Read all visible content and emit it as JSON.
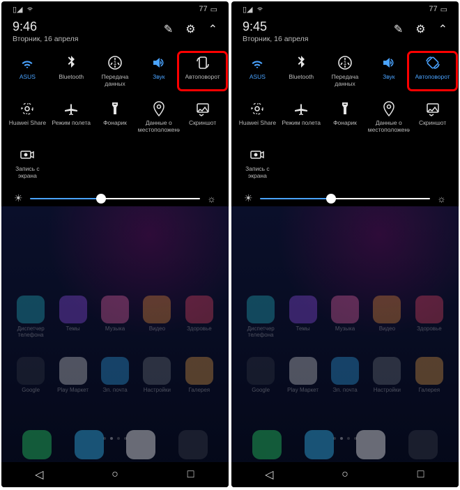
{
  "screens": [
    {
      "key": "left",
      "status": {
        "battery": "77"
      },
      "time": "9:46",
      "date": "Вторник, 16 апреля",
      "tiles": [
        {
          "id": "wifi",
          "label": "ASUS",
          "active": true,
          "highlight": false
        },
        {
          "id": "bluetooth",
          "label": "Bluetooth",
          "active": false,
          "highlight": false
        },
        {
          "id": "data",
          "label": "Передача данных",
          "active": false,
          "highlight": false
        },
        {
          "id": "sound",
          "label": "Звук",
          "active": true,
          "highlight": false
        },
        {
          "id": "autorotate",
          "label": "Автоповорот",
          "active": false,
          "highlight": true
        },
        {
          "id": "share",
          "label": "Huawei Share",
          "active": false,
          "highlight": false
        },
        {
          "id": "airplane",
          "label": "Режим полета",
          "active": false,
          "highlight": false
        },
        {
          "id": "flashlight",
          "label": "Фонарик",
          "active": false,
          "highlight": false
        },
        {
          "id": "location",
          "label": "Данные о местоположении",
          "active": false,
          "highlight": false
        },
        {
          "id": "screenshot",
          "label": "Скриншот",
          "active": false,
          "highlight": false
        },
        {
          "id": "record",
          "label": "Запись с экрана",
          "active": false,
          "highlight": false
        }
      ],
      "slider": 42,
      "apps": [
        {
          "label": "Диспетчер телефона",
          "color": "#29c8d6"
        },
        {
          "label": "Темы",
          "color": "#a259ff"
        },
        {
          "label": "Музыка",
          "color": "#ff6fb5"
        },
        {
          "label": "Видео",
          "color": "#ff9f3e"
        },
        {
          "label": "Здоровье",
          "color": "#ff4d6d"
        },
        {
          "label": "Google",
          "color": "#3a3f4a"
        },
        {
          "label": "Play Маркет",
          "color": "#eaeaea"
        },
        {
          "label": "Эл. почта",
          "color": "#37b6ff"
        },
        {
          "label": "Настройки",
          "color": "#7a8288"
        },
        {
          "label": "Галерея",
          "color": "#ffb14d"
        }
      ],
      "dock": [
        {
          "id": "phone",
          "color": "#29d66a"
        },
        {
          "id": "messages",
          "color": "#39c2ff"
        },
        {
          "id": "browser",
          "color": "#ffffff"
        },
        {
          "id": "camera",
          "color": "#3a3f4a"
        }
      ]
    },
    {
      "key": "right",
      "status": {
        "battery": "77"
      },
      "time": "9:45",
      "date": "Вторник, 16 апреля",
      "tiles": [
        {
          "id": "wifi",
          "label": "ASUS",
          "active": true,
          "highlight": false
        },
        {
          "id": "bluetooth",
          "label": "Bluetooth",
          "active": false,
          "highlight": false
        },
        {
          "id": "data",
          "label": "Передача данных",
          "active": false,
          "highlight": false
        },
        {
          "id": "sound",
          "label": "Звук",
          "active": true,
          "highlight": false
        },
        {
          "id": "autorotate-on",
          "label": "Автоповорот",
          "active": true,
          "highlight": true
        },
        {
          "id": "share",
          "label": "Huawei Share",
          "active": false,
          "highlight": false
        },
        {
          "id": "airplane",
          "label": "Режим полета",
          "active": false,
          "highlight": false
        },
        {
          "id": "flashlight",
          "label": "Фонарик",
          "active": false,
          "highlight": false
        },
        {
          "id": "location",
          "label": "Данные о местоположении",
          "active": false,
          "highlight": false
        },
        {
          "id": "screenshot",
          "label": "Скриншот",
          "active": false,
          "highlight": false
        },
        {
          "id": "record",
          "label": "Запись с экрана",
          "active": false,
          "highlight": false
        }
      ],
      "slider": 42,
      "apps": [
        {
          "label": "Диспетчер телефона",
          "color": "#29c8d6"
        },
        {
          "label": "Темы",
          "color": "#a259ff"
        },
        {
          "label": "Музыка",
          "color": "#ff6fb5"
        },
        {
          "label": "Видео",
          "color": "#ff9f3e"
        },
        {
          "label": "Здоровье",
          "color": "#ff4d6d"
        },
        {
          "label": "Google",
          "color": "#3a3f4a"
        },
        {
          "label": "Play Маркет",
          "color": "#eaeaea"
        },
        {
          "label": "Эл. почта",
          "color": "#37b6ff"
        },
        {
          "label": "Настройки",
          "color": "#7a8288"
        },
        {
          "label": "Галерея",
          "color": "#ffb14d"
        }
      ],
      "dock": [
        {
          "id": "phone",
          "color": "#29d66a"
        },
        {
          "id": "messages",
          "color": "#39c2ff"
        },
        {
          "id": "browser",
          "color": "#ffffff"
        },
        {
          "id": "camera",
          "color": "#3a3f4a"
        }
      ]
    }
  ],
  "icons": {
    "wifi": "<path d='M12 20l-1.5-1.5c.8-.8 2.2-.8 3 0L12 20zm-4.5-4.5c2.5-2.5 6.5-2.5 9 0l-1.5 1.5c-1.7-1.7-4.3-1.7-6 0l-1.5-1.5zm-3-3c4.1-4.1 10.9-4.1 15 0l-1.5 1.5c-3.3-3.3-8.7-3.3-12 0l-1.5-1.5z' fill='currentColor'/>",
    "bluetooth": "<path d='M12 2l5 5-3.5 3.5L17 14l-5 5v-7l-3 3-1.4-1.4L12 9.2 7.6 4.8 9 3.4l3 3V2z' fill='currentColor'/>",
    "data": "<circle cx='12' cy='12' r='9' fill='none' stroke='currentColor' stroke-width='1.6'/><path d='M8 12l-2 3m10-3l2 3M12 8V5m0 14v-3' stroke='currentColor' stroke-width='1.6'/><text x='12' y='15' font-size='8' text-anchor='middle' fill='currentColor'>1</text>",
    "sound": "<path d='M4 9v6h4l5 4V5L8 9H4zm12 3c0-1.3-.8-2.4-2-2.8v5.6c1.2-.4 2-1.5 2-2.8zm2.5 0c0 2.6-1.6 4.8-4 5.7v-1.7c1.5-.8 2.5-2.3 2.5-4s-1-3.2-2.5-4V6.3c2.4.9 4 3.1 4 5.7z' fill='currentColor'/>",
    "autorotate": "<rect x='7' y='4' width='10' height='16' rx='2' fill='none' stroke='currentColor' stroke-width='1.6'/><path d='M4 10c0-3 2-5 4-5m12 9c0 3-2 5-4 5' stroke='currentColor' stroke-width='1.6' fill='none'/>",
    "autorotate-on": "<rect x='6' y='6' width='12' height='12' rx='2' transform='rotate(45 12 12)' fill='none' stroke='currentColor' stroke-width='1.6'/><path d='M3 10c1-4 4-6 7-6m11 10c-1 4-4 6-7 6' stroke='currentColor' stroke-width='1.6' fill='none'/>",
    "share": "<circle cx='12' cy='12' r='3' fill='none' stroke='currentColor' stroke-width='1.6'/><path d='M5 12c0-.5 0-1 .1-1.4M19 12c0 .5 0 1-.1 1.4M12 5c.5 0 1 0 1.4.1M12 19c-.5 0-1 0-1.4-.1' stroke='currentColor' stroke-width='1.6'/><circle cx='12' cy='12' r='8' fill='none' stroke='currentColor' stroke-width='1.2' stroke-dasharray='3 5'/>",
    "airplane": "<path d='M21 14l-8-2V7c0-1-.5-2-1-2s-1 1-1 2v5l-8 2v2l8-1v4l-2 1v1l3-.5 3 .5v-1l-2-1v-4l8 1v-2z' fill='currentColor'/>",
    "flashlight": "<path d='M8 3h8v4l-2 3v10h-4V10L8 7V3zm2 2v1h4V5h-4z' fill='currentColor'/>",
    "location": "<path d='M12 2c-3.9 0-7 3.1-7 7 0 5 7 13 7 13s7-8 7-13c0-3.9-3.1-7-7-7zm0 9.5c-1.4 0-2.5-1.1-2.5-2.5S10.6 6.5 12 6.5s2.5 1.1 2.5 2.5-1.1 2.5-2.5 2.5z' fill='none' stroke='currentColor' stroke-width='1.5'/>",
    "screenshot": "<rect x='4' y='5' width='16' height='12' rx='1.5' fill='none' stroke='currentColor' stroke-width='1.5'/><path d='M4 17l4-4 3 2 4-5 5 7' stroke='currentColor' stroke-width='1.5' fill='none'/><path d='M7 20l3 2 3-2' stroke='currentColor' stroke-width='1.5' fill='none'/>",
    "record": "<rect x='3' y='7' width='14' height='10' rx='1.5' fill='none' stroke='currentColor' stroke-width='1.5'/><circle cx='10' cy='12' r='2.5' fill='currentColor'/><path d='M17 10l4-2v8l-4-2' fill='none' stroke='currentColor' stroke-width='1.5'/>"
  }
}
